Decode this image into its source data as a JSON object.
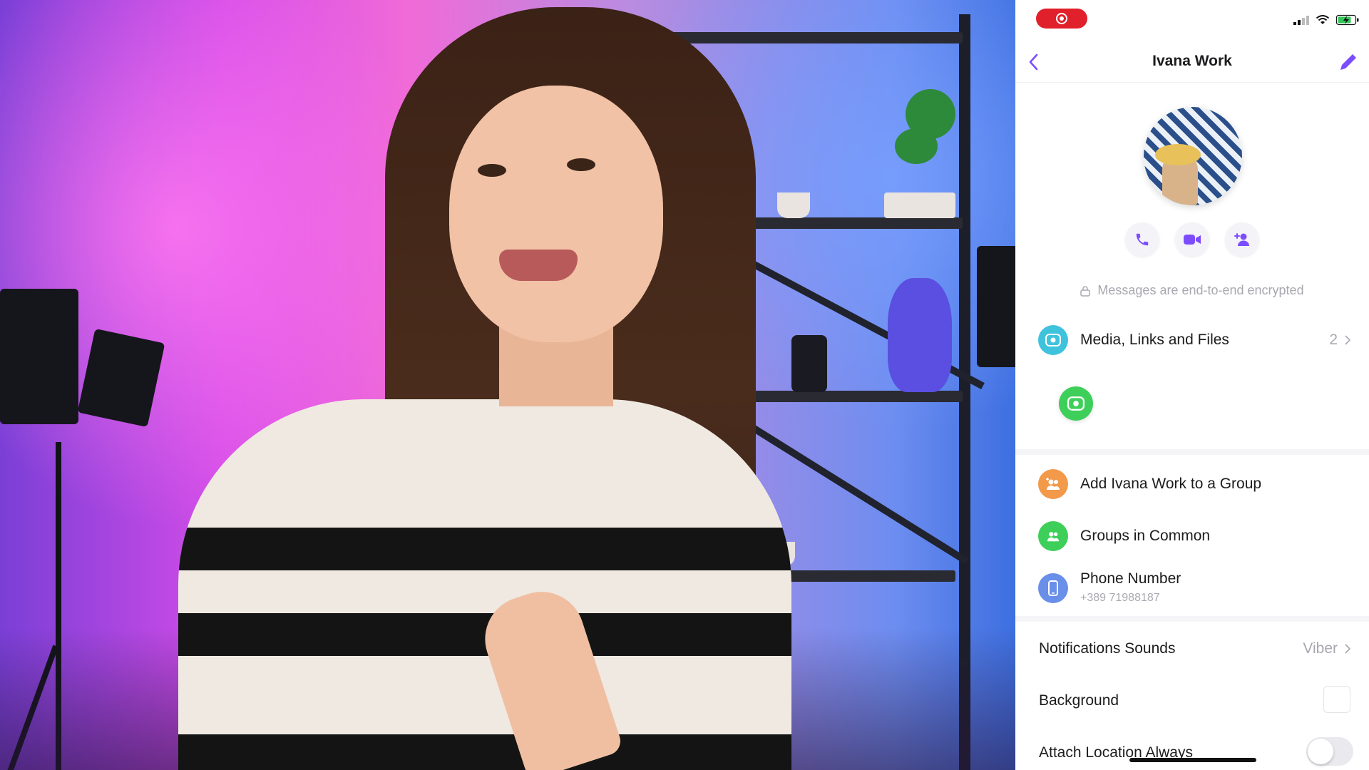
{
  "phone": {
    "nav": {
      "title": "Ivana Work"
    },
    "encrypted_text": "Messages are end-to-end encrypted",
    "media": {
      "label": "Media, Links and Files",
      "count": "2"
    },
    "add_to_group": {
      "label": "Add Ivana Work to a Group"
    },
    "groups_in_common": {
      "label": "Groups in Common"
    },
    "phone_number": {
      "label": "Phone Number",
      "value": "+389 71988187"
    },
    "notification_sounds": {
      "label": "Notifications Sounds",
      "value": "Viber"
    },
    "background": {
      "label": "Background"
    },
    "attach_location": {
      "label": "Attach Location Always",
      "enabled": false
    },
    "colors": {
      "accent": "#7c4dff",
      "media_icon": "#3fc3dd",
      "add_group_icon": "#f2994a",
      "groups_common_icon": "#3ecf5a",
      "phone_icon": "#6a8fe8",
      "recording": "#e0202a"
    },
    "icons": {
      "back": "chevron-left-icon",
      "edit": "pencil-icon",
      "call": "phone-icon",
      "video": "video-camera-icon",
      "add_contact": "add-person-icon",
      "lock": "lock-icon",
      "media": "gallery-icon",
      "chevron": "chevron-right-icon"
    }
  }
}
